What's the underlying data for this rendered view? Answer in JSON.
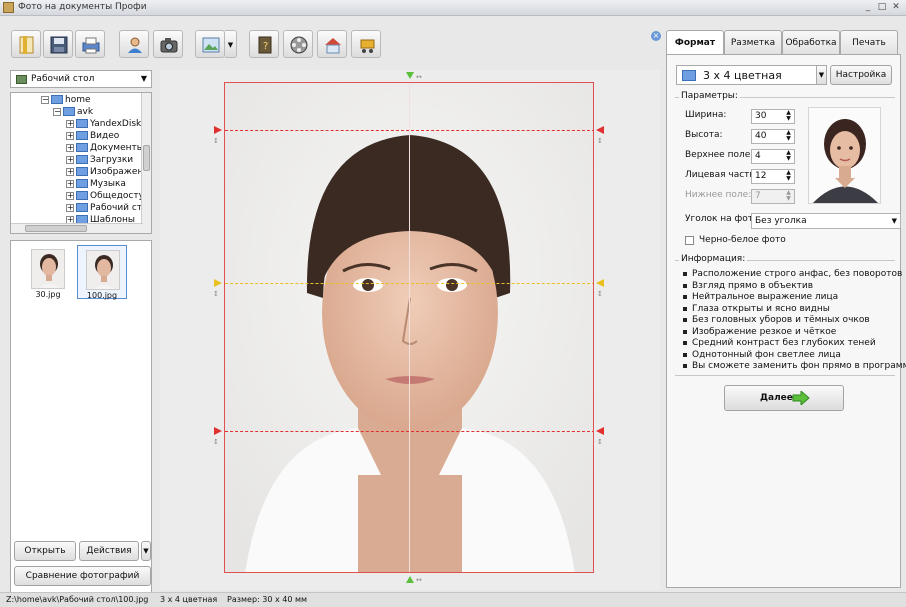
{
  "window": {
    "title": "Фото на документы Профи"
  },
  "toolbar": {
    "buttons": [
      {
        "name": "open-wizard",
        "icon": "wizard-icon"
      },
      {
        "name": "save",
        "icon": "save-icon"
      },
      {
        "name": "print",
        "icon": "printer-icon"
      },
      {
        "name": "person",
        "icon": "person-icon"
      },
      {
        "name": "camera",
        "icon": "camera-icon"
      },
      {
        "name": "image-edit",
        "icon": "image-icon"
      },
      {
        "name": "help",
        "icon": "help-book-icon"
      },
      {
        "name": "video",
        "icon": "film-reel-icon"
      },
      {
        "name": "home",
        "icon": "home-icon"
      },
      {
        "name": "cart",
        "icon": "cart-icon"
      }
    ]
  },
  "left": {
    "folder_select": "Рабочий стол",
    "tree": [
      {
        "label": "home",
        "level": 0,
        "expanded": true
      },
      {
        "label": "avk",
        "level": 1,
        "expanded": true
      },
      {
        "label": "YandexDisk",
        "level": 2
      },
      {
        "label": "Видео",
        "level": 2
      },
      {
        "label": "Документы",
        "level": 2
      },
      {
        "label": "Загрузки",
        "level": 2
      },
      {
        "label": "Изображени",
        "level": 2
      },
      {
        "label": "Музыка",
        "level": 2
      },
      {
        "label": "Общедосту",
        "level": 2
      },
      {
        "label": "Рабочий сто",
        "level": 2
      },
      {
        "label": "Шаблоны",
        "level": 2
      }
    ],
    "thumbnails": [
      {
        "caption": "30.jpg",
        "selected": false
      },
      {
        "caption": "100.jpg",
        "selected": true
      }
    ],
    "open_button": "Открыть",
    "actions_button": "Действия",
    "compare_button": "Сравнение фотографий"
  },
  "right": {
    "tabs": [
      "Формат",
      "Разметка",
      "Обработка",
      "Печать"
    ],
    "active_tab": "Формат",
    "format_value": "3 x 4 цветная",
    "settings_button": "Настройка",
    "params_title": "Параметры:",
    "params": [
      {
        "label": "Ширина:",
        "value": "30",
        "disabled": false
      },
      {
        "label": "Высота:",
        "value": "40",
        "disabled": false
      },
      {
        "label": "Верхнее поле:",
        "value": "4",
        "disabled": false
      },
      {
        "label": "Лицевая часть:",
        "value": "12",
        "disabled": false
      },
      {
        "label": "Нижнее поле:",
        "value": "7",
        "disabled": true
      }
    ],
    "corner_label": "Уголок на фото:",
    "corner_value": "Без уголка",
    "bw_label": "Черно-белое фото",
    "info_title": "Информация:",
    "info": [
      "Расположение строго анфас, без поворотов",
      "Взгляд прямо в объектив",
      "Нейтральное выражение лица",
      "Глаза открыты и ясно видны",
      "Без головных уборов и тёмных очков",
      "Изображение резкое и чёткое",
      "Средний контраст без глубоких теней",
      "Однотонный фон светлее лица",
      "Вы сможете заменить фон прямо в программе!"
    ],
    "next_button": "Далее"
  },
  "status": {
    "path": "Z:\\home\\avk\\Рабочий стол\\100.jpg",
    "format": "3 x 4 цветная",
    "size": "Размер: 30 x 40 мм"
  },
  "colors": {
    "guide_red": "#e03030",
    "guide_yellow": "#e8c020",
    "marker_green": "#5cbf3a",
    "accent_blue": "#5a8fd6"
  }
}
